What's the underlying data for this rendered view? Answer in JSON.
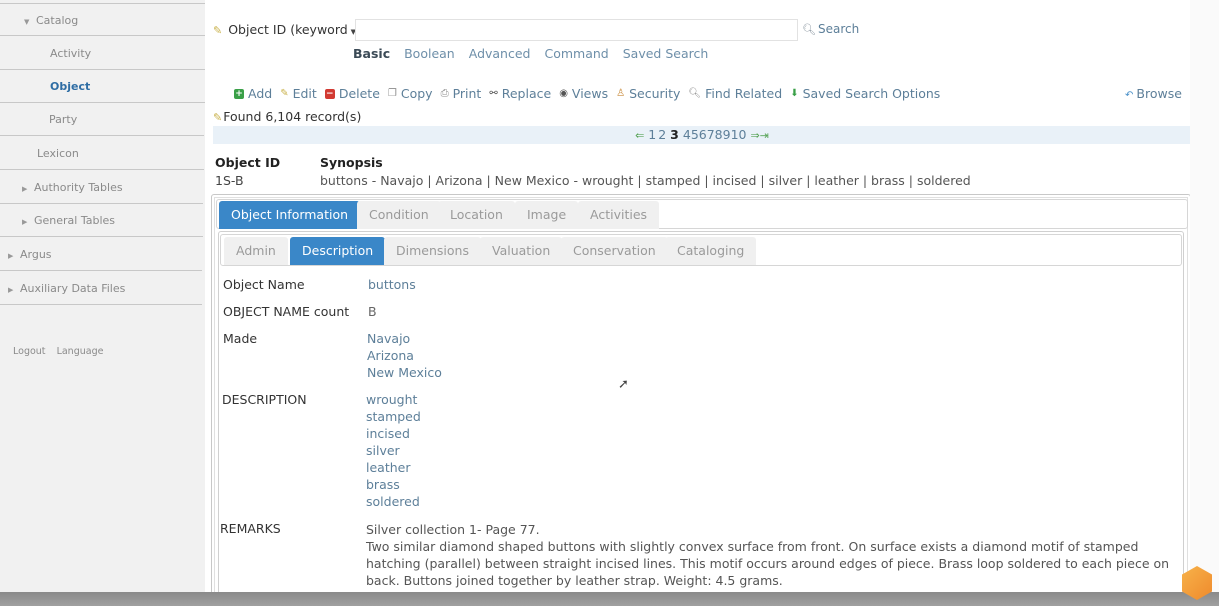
{
  "sidebar": {
    "items": [
      {
        "label": "Catalog",
        "expander": "▼",
        "state": "expanded"
      },
      {
        "label": "Activity"
      },
      {
        "label": "Object",
        "active": true
      },
      {
        "label": "Party"
      },
      {
        "label": "Lexicon"
      },
      {
        "label": "Authority Tables",
        "expander": "▶"
      },
      {
        "label": "General Tables",
        "expander": "▶"
      },
      {
        "label": "Argus",
        "expander": "▶"
      },
      {
        "label": "Auxiliary Data Files",
        "expander": "▶"
      }
    ],
    "footer": {
      "logout": "Logout",
      "language": "Language"
    }
  },
  "search": {
    "field_select": "Object ID (keyword",
    "input_value": "",
    "button_label": "Search",
    "modes": [
      "Basic",
      "Boolean",
      "Advanced",
      "Command",
      "Saved Search"
    ],
    "active_mode": "Basic"
  },
  "toolbar": {
    "add": "Add",
    "edit": "Edit",
    "delete": "Delete",
    "copy": "Copy",
    "print": "Print",
    "replace": "Replace",
    "views": "Views",
    "security": "Security",
    "find_related": "Find Related",
    "saved_search_options": "Saved Search Options",
    "browse": "Browse"
  },
  "results": {
    "found_text": "Found 6,104 record(s)",
    "pages": [
      "1",
      "2",
      "3",
      "4",
      "5",
      "6",
      "7",
      "8",
      "9",
      "10"
    ],
    "current_page": "3"
  },
  "record": {
    "id_header": "Object ID",
    "synopsis_header": "Synopsis",
    "id_value": "1S-B",
    "synopsis_value": "buttons - Navajo | Arizona | New Mexico - wrought | stamped | incised | silver | leather | brass | soldered"
  },
  "tabs_primary": [
    "Object Information",
    "Condition",
    "Location",
    "Image",
    "Activities"
  ],
  "tabs_primary_active": "Object Information",
  "tabs_secondary": [
    "Admin",
    "Description",
    "Dimensions",
    "Valuation",
    "Conservation",
    "Cataloging"
  ],
  "tabs_secondary_active": "Description",
  "fields": {
    "object_name": {
      "label": "Object Name",
      "values": [
        "buttons"
      ]
    },
    "object_name_count": {
      "label": "OBJECT NAME count",
      "values": [
        "B"
      ]
    },
    "made": {
      "label": "Made",
      "values": [
        "Navajo",
        "Arizona",
        "New Mexico"
      ]
    },
    "description": {
      "label": "DESCRIPTION",
      "values": [
        "wrought",
        "stamped",
        "incised",
        "silver",
        "leather",
        "brass",
        "soldered"
      ]
    },
    "remarks": {
      "label": "REMARKS",
      "line1": "Silver collection 1- Page 77.",
      "line2": "Two similar diamond shaped buttons with slightly convex surface from front. On surface exists a diamond motif of stamped hatching (parallel) between straight incised lines. This motif occurs around edges of piece. Brass loop soldered to each piece on back. Buttons joined together by leather strap. Weight: 4.5 grams."
    }
  },
  "colors": {
    "accent": "#3a87c8",
    "link": "#5d7f99",
    "pager_bg": "#e9f1f8"
  }
}
